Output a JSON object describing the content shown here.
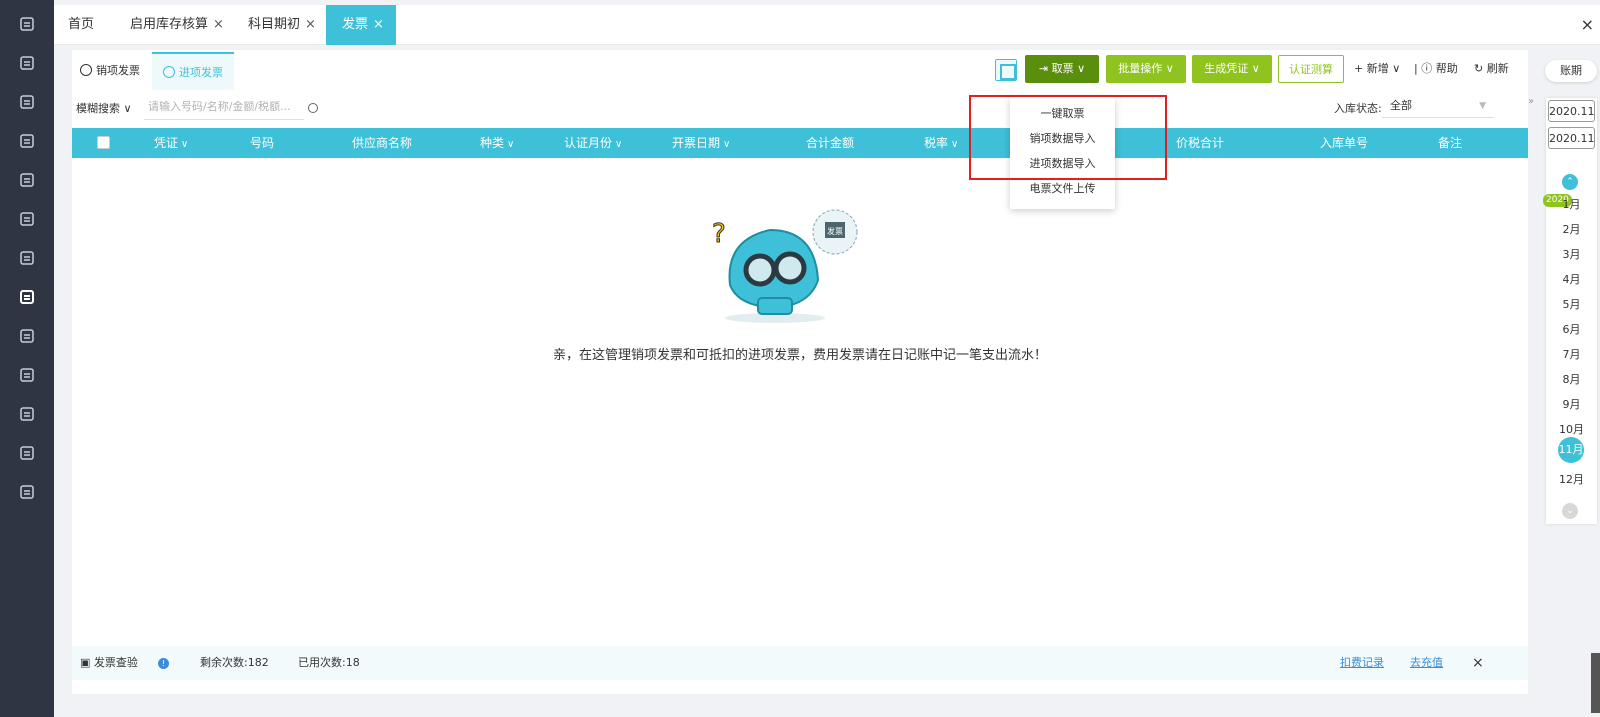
{
  "rail": {
    "icons": [
      "home-icon",
      "search-doc-icon",
      "ledger-icon",
      "chart-icon",
      "money-bag-icon",
      "report-icon",
      "stats-icon",
      "invoice-icon",
      "wallet-icon",
      "building-icon",
      "coins-icon",
      "doc-check-icon",
      "settings-icon"
    ],
    "active_index": 7
  },
  "top_tabs": [
    {
      "label": "首页",
      "closable": false
    },
    {
      "label": "启用库存核算",
      "closable": true
    },
    {
      "label": "科目期初",
      "closable": true
    },
    {
      "label": "发票",
      "closable": true,
      "active": true
    }
  ],
  "close_symbol": "×",
  "sub_tabs": {
    "sales": "销项发票",
    "purchase": "进项发票"
  },
  "toolbar": {
    "qupiao": "取票",
    "batch": "批量操作",
    "generate": "生成凭证",
    "auth": "认证测算",
    "add": "新增",
    "help": "帮助",
    "refresh": "刷新"
  },
  "search": {
    "mode": "模糊搜索",
    "placeholder": "请输入号码/名称/金额/税额..."
  },
  "filter": {
    "label": "入库状态:",
    "value": "全部"
  },
  "columns": [
    {
      "label": "凭证",
      "dropdown": true
    },
    {
      "label": "号码",
      "dropdown": false
    },
    {
      "label": "供应商名称",
      "dropdown": false
    },
    {
      "label": "种类",
      "dropdown": true
    },
    {
      "label": "认证月份",
      "dropdown": true
    },
    {
      "label": "开票日期",
      "dropdown": true
    },
    {
      "label": "合计金额",
      "dropdown": false
    },
    {
      "label": "税率",
      "dropdown": true
    },
    {
      "label": "价税合计",
      "dropdown": false
    },
    {
      "label": "入库单号",
      "dropdown": false
    },
    {
      "label": "备注",
      "dropdown": false
    }
  ],
  "empty": {
    "message": "亲，在这管理销项发票和可抵扣的进项发票，费用发票请在日记账中记一笔支出流水！",
    "bubble_text": "发票"
  },
  "dropdown_menu": [
    "一键取票",
    "销项数据导入",
    "进项数据导入",
    "电票文件上传"
  ],
  "footer": {
    "check_label": "发票查验",
    "remaining_label": "剩余次数:",
    "remaining": 182,
    "used_label": "已用次数:",
    "used": 18,
    "deduct_link": "扣费记录",
    "recharge_link": "去充值"
  },
  "period": {
    "title": "账期",
    "start": "2020.11",
    "end": "2020.11",
    "year": "2020",
    "months": [
      "1月",
      "2月",
      "3月",
      "4月",
      "5月",
      "6月",
      "7月",
      "8月",
      "9月",
      "10月",
      "11月",
      "12月"
    ],
    "selected_index": 10
  },
  "colors": {
    "accent": "#3ec1d8",
    "green_dark": "#5a8f0e",
    "green": "#8fc31f",
    "highlight": "#e02020",
    "rail": "#2f3542"
  }
}
